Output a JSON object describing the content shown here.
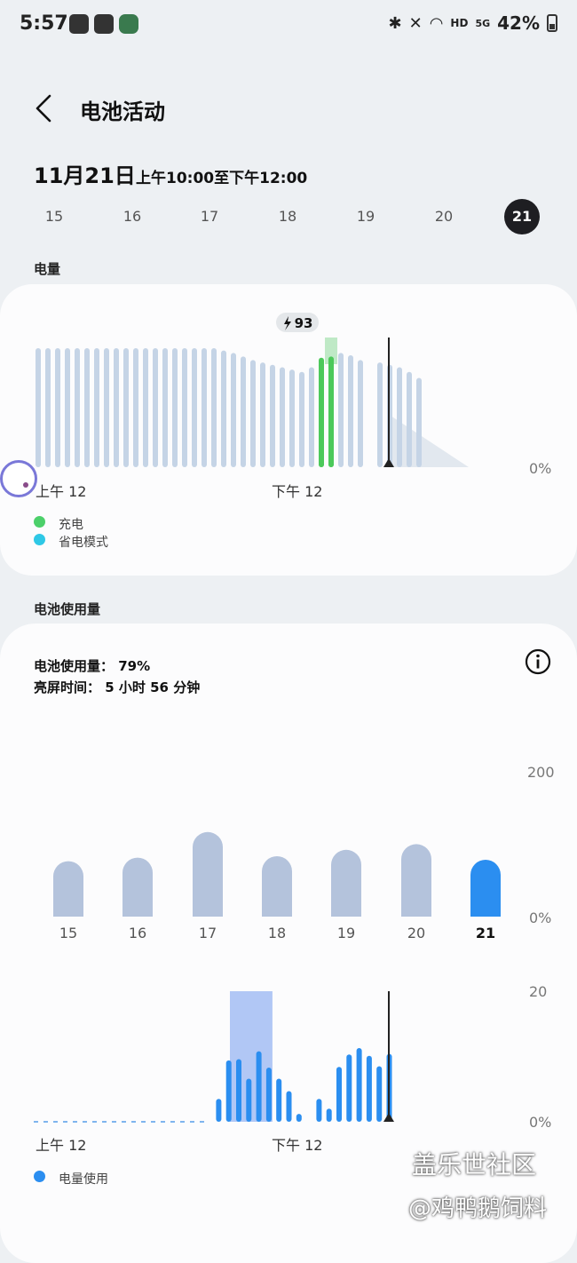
{
  "status_bar": {
    "time": "5:57",
    "network": "HD",
    "signal": "5G",
    "battery": "42%",
    "left_icons": [
      "wechat-icon",
      "gallery-icon",
      "avatar-icon"
    ],
    "right_icons": [
      "bluetooth-icon",
      "mute-icon",
      "wifi-icon"
    ]
  },
  "header": {
    "title": "电池活动",
    "back_icon": "chevron-left-icon"
  },
  "date": {
    "main": "11月21日",
    "range": "上午10:00至下午12:00"
  },
  "days": [
    "15",
    "16",
    "17",
    "18",
    "19",
    "20",
    "21"
  ],
  "active_day": "21",
  "battery_section": {
    "label": "电量",
    "x_labels": [
      "上午 12",
      "下午 12"
    ],
    "y_label_bottom": "0%",
    "peak_badge": "93",
    "legend": [
      {
        "label": "充电",
        "color": "#4cd06a"
      },
      {
        "label": "省电模式",
        "color": "#2ec8e6"
      }
    ]
  },
  "usage_section": {
    "label": "电池使用量",
    "usage_text": "电池使用量： 79%",
    "screen_time_text": "亮屏时间： 5 小时 56 分钟",
    "weekly_y_top": "200",
    "weekly_y_bottom": "0%",
    "hourly_y_top": "20",
    "hourly_y_bottom": "0%",
    "hourly_x_labels": [
      "上午 12",
      "下午 12"
    ],
    "legend": [
      {
        "label": "电量使用",
        "color": "#2b8ef0"
      }
    ]
  },
  "watermark": {
    "line1": "盖乐世社区",
    "line2": "@鸡鸭鹅饲料"
  },
  "chart_data": [
    {
      "type": "bar",
      "title": "",
      "x_range_labels": [
        "上午 12",
        "下午 12"
      ],
      "y_range": [
        0,
        100
      ],
      "units": "%",
      "values": [
        100,
        100,
        100,
        100,
        100,
        100,
        100,
        100,
        100,
        100,
        100,
        100,
        100,
        100,
        100,
        100,
        100,
        100,
        100,
        98,
        96,
        93,
        90,
        88,
        86,
        84,
        82,
        80,
        84,
        92,
        98,
        96,
        94,
        90,
        null,
        88,
        86,
        84,
        80,
        75
      ],
      "charging_indices": [
        29,
        30
      ],
      "peak_label": "93",
      "projection_end_value": 0
    },
    {
      "type": "bar",
      "title": "",
      "categories": [
        "15",
        "16",
        "17",
        "18",
        "19",
        "20",
        "21"
      ],
      "values": [
        78,
        83,
        119,
        85,
        94,
        102,
        80
      ],
      "highlight": "21",
      "ylim": [
        0,
        200
      ]
    },
    {
      "type": "bar",
      "title": "",
      "x_range_labels": [
        "上午 12",
        "下午 12"
      ],
      "ylim": [
        0,
        20
      ],
      "values": [
        0.4,
        0.4,
        0.3,
        0.3,
        0.5,
        0.3,
        0.3,
        0.3,
        0.4,
        0.4,
        0.3,
        0.4,
        0.4,
        0.3,
        0.3,
        0.3,
        0.3,
        0.2,
        3.5,
        9.4,
        9.6,
        6.6,
        10.8,
        8.3,
        6.6,
        4.7,
        1.2,
        0,
        3.5,
        2.0,
        8.4,
        10.3,
        11.3,
        10.1,
        8.5,
        10.4
      ],
      "highlight_range_start": 20,
      "highlight_range_end": 23
    }
  ]
}
